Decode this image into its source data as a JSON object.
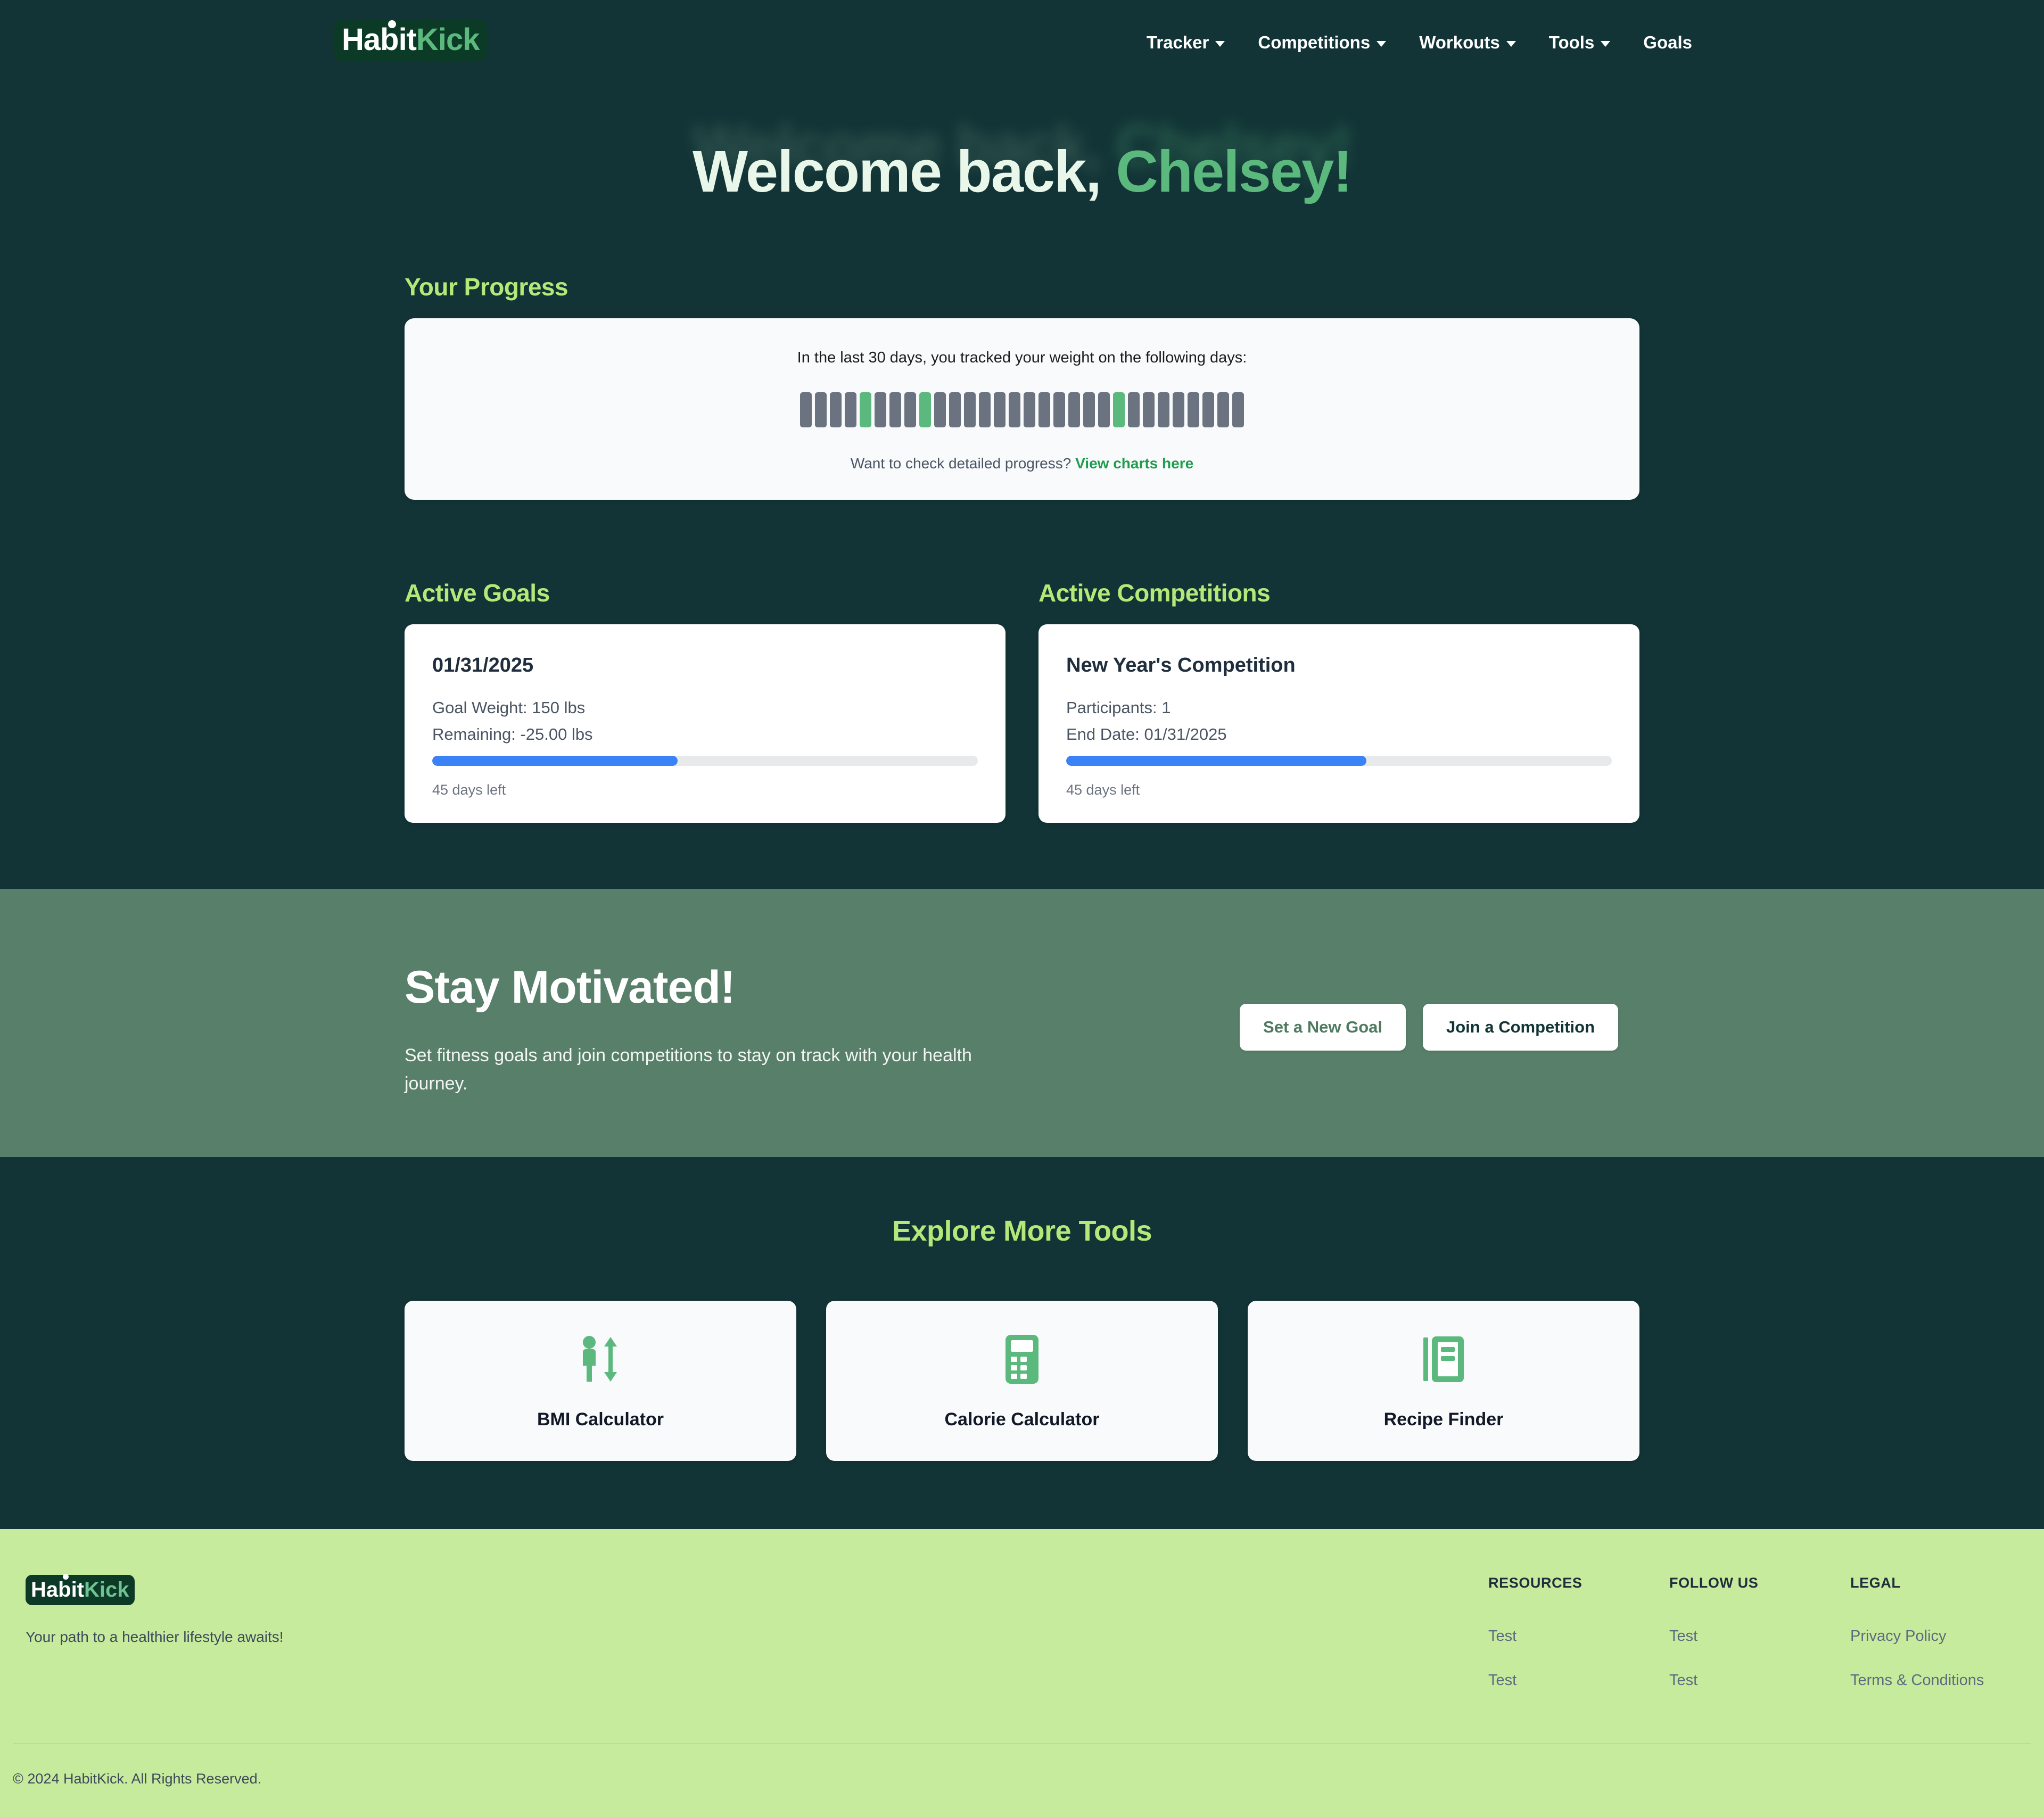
{
  "brand": {
    "name_part1": "Habit",
    "name_part2": "Kick",
    "accent_green": "#5cb97e",
    "dark_teal": "#123436",
    "light_green": "#b4e878",
    "footer_bg": "#c7eb9c"
  },
  "nav": {
    "items": [
      {
        "label": "Tracker",
        "has_dropdown": true
      },
      {
        "label": "Competitions",
        "has_dropdown": true
      },
      {
        "label": "Workouts",
        "has_dropdown": true
      },
      {
        "label": "Tools",
        "has_dropdown": true
      },
      {
        "label": "Goals",
        "has_dropdown": false
      }
    ],
    "avatar_icon": "user-avatar-photo"
  },
  "hero": {
    "greeting": "Welcome back,",
    "user_name": "Chelsey!"
  },
  "progress": {
    "heading": "Your Progress",
    "caption": "In the last 30 days, you tracked your weight on the following days:",
    "footer_text": "Want to check detailed progress?",
    "footer_link": "View charts here",
    "total_days": 30,
    "tracked_days": [
      5,
      9,
      22
    ],
    "bar_color_untracked": "#6b7280",
    "bar_color_tracked": "#5cb97e"
  },
  "goals": {
    "heading": "Active Goals",
    "items": [
      {
        "title": "01/31/2025",
        "line1": "Goal Weight: 150 lbs",
        "line2": "Remaining: -25.00 lbs",
        "progress_percent": 45,
        "meta": "45 days left"
      }
    ]
  },
  "competitions": {
    "heading": "Active Competitions",
    "items": [
      {
        "title": "New Year's Competition",
        "line1": "Participants: 1",
        "line2": "End Date: 01/31/2025",
        "progress_percent": 55,
        "meta": "45 days left"
      }
    ]
  },
  "motivate": {
    "title": "Stay Motivated!",
    "subtitle": "Set fitness goals and join competitions to stay on track with your health journey.",
    "btn_goal": "Set a New Goal",
    "btn_competition": "Join a Competition"
  },
  "tools": {
    "heading": "Explore More Tools",
    "items": [
      {
        "label": "BMI Calculator",
        "icon": "height-person-icon"
      },
      {
        "label": "Calorie Calculator",
        "icon": "calculator-icon"
      },
      {
        "label": "Recipe Finder",
        "icon": "book-icon"
      }
    ]
  },
  "footer": {
    "tagline": "Your path to a healthier lifestyle awaits!",
    "columns": [
      {
        "title": "RESOURCES",
        "links": [
          "Test",
          "Test"
        ]
      },
      {
        "title": "FOLLOW US",
        "links": [
          "Test",
          "Test"
        ]
      },
      {
        "title": "LEGAL",
        "links": [
          "Privacy Policy",
          "Terms & Conditions"
        ]
      }
    ],
    "copyright": "© 2024 HabitKick. All Rights Reserved."
  }
}
